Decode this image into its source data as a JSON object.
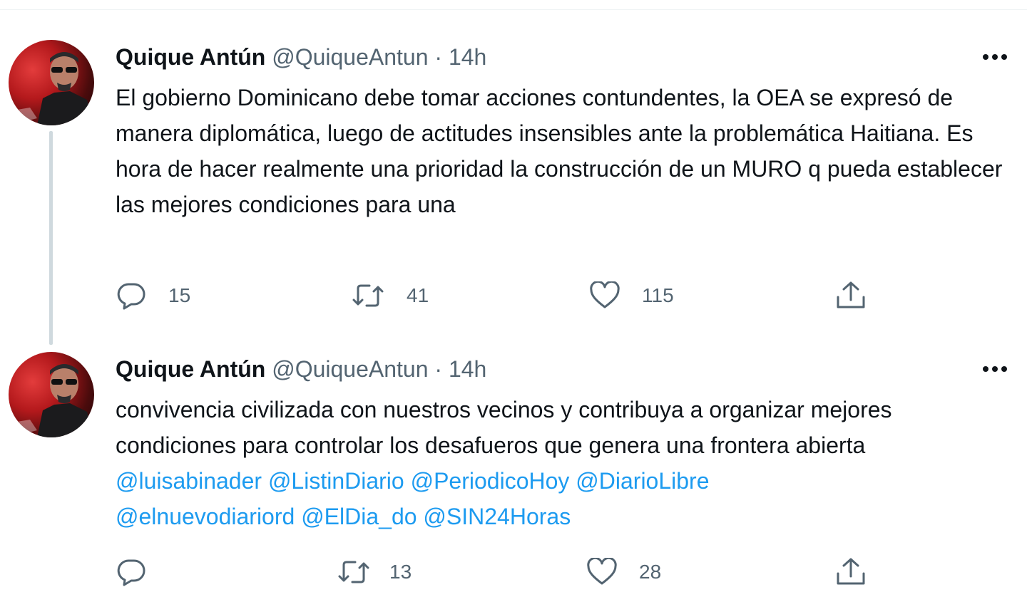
{
  "tweets": [
    {
      "author_name": "Quique Antún",
      "author_handle": "@QuiqueAntun",
      "separator": "·",
      "time": "14h",
      "text": "El gobierno Dominicano debe tomar acciones contundentes, la OEA se expresó de manera diplomática, luego de actitudes insensibles ante la problemática Haitiana. Es hora de hacer realmente una prioridad la construcción de un MURO q pueda establecer las mejores condiciones para una",
      "replies": "15",
      "retweets": "41",
      "likes": "115"
    },
    {
      "author_name": "Quique Antún",
      "author_handle": "@QuiqueAntun",
      "separator": "·",
      "time": "14h",
      "text": "convivencia civilizada con nuestros vecinos y contribuya a organizar mejores condiciones para controlar los desafueros que genera una frontera abierta",
      "mentions": [
        "@luisabinader",
        "@ListinDiario",
        "@PeriodicoHoy",
        "@DiarioLibre",
        "@elnuevodiariord",
        "@ElDia_do",
        "@SIN24Horas"
      ],
      "replies": "",
      "retweets": "13",
      "likes": "28"
    }
  ],
  "icons": {
    "reply": "reply-icon",
    "retweet": "retweet-icon",
    "like": "heart-icon",
    "share": "share-icon",
    "more": "more-icon"
  },
  "colors": {
    "text": "#0f1419",
    "secondary": "#536471",
    "link": "#1d9bf0",
    "thread_line": "#cfd9de"
  }
}
